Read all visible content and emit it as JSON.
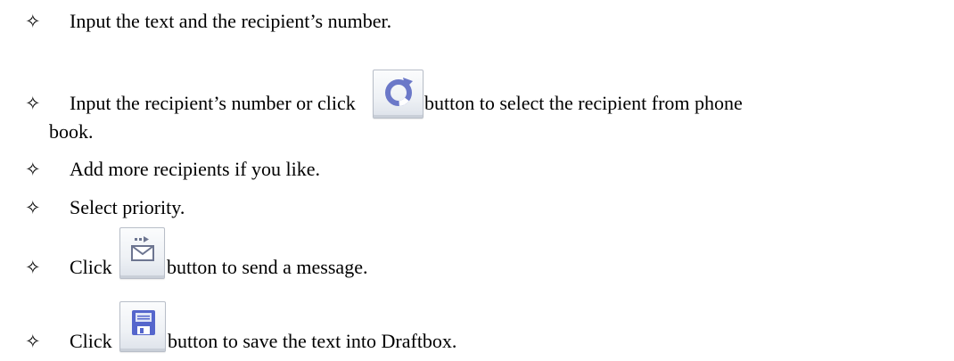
{
  "bullets": {
    "glyph": "✧",
    "item1": {
      "text": "Input the text and the recipient’s number."
    },
    "item2": {
      "before": "Input the recipient’s number or click",
      "after": "button to select the recipient from phone",
      "continuation": "book.",
      "button_icon": "refresh-icon"
    },
    "item3": {
      "text": "Add more recipients if you like."
    },
    "item4": {
      "text": "Select priority."
    },
    "item5": {
      "before": "Click",
      "after": "button to send a message.",
      "button_icon": "send-message-icon"
    },
    "item6": {
      "before": "Click",
      "after": "button to save the text into Draftbox.",
      "button_icon": "save-draft-icon"
    }
  },
  "colors": {
    "refresh_icon": "#6b78c8",
    "send_icon": "#6d7590",
    "save_icon": "#5566cc"
  }
}
